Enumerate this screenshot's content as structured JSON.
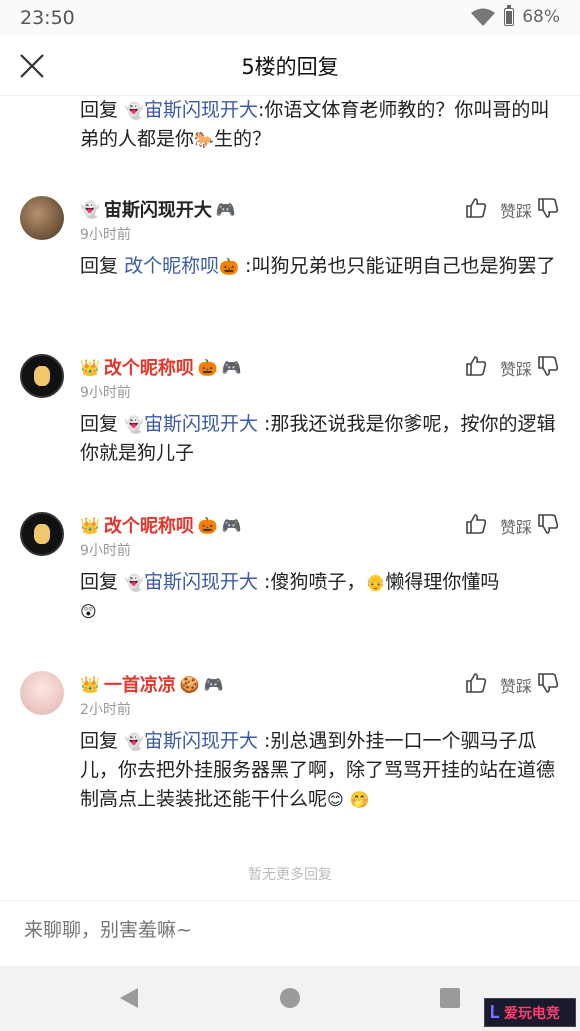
{
  "status": {
    "time": "23:50",
    "battery": "68%"
  },
  "header": {
    "title": "5楼的回复"
  },
  "first_reply": {
    "prefix": "回复",
    "mention": "宙斯闪现开大",
    "text_a": ":你语文体育老师教的？你叫哥的叫弟的人都是你",
    "text_b": "生的？"
  },
  "comments": [
    {
      "name": "宙斯闪现开大",
      "time": "9小时前",
      "reply_prefix": "回复",
      "reply_to": "改个昵称呗",
      "text": ":叫狗兄弟也只能证明自己也是狗罢了",
      "like_label": "赞踩"
    },
    {
      "name": "改个昵称呗",
      "time": "9小时前",
      "reply_prefix": "回复",
      "reply_to": "宙斯闪现开大",
      "text": ":那我还说我是你爹呢，按你的逻辑你就是狗儿子",
      "like_label": "赞踩"
    },
    {
      "name": "改个昵称呗",
      "time": "9小时前",
      "reply_prefix": "回复",
      "reply_to": "宙斯闪现开大",
      "text_a": ":傻狗喷子，",
      "text_b": "懒得理你懂吗",
      "like_label": "赞踩"
    },
    {
      "name": "一首凉凉",
      "time": "2小时前",
      "reply_prefix": "回复",
      "reply_to": "宙斯闪现开大",
      "text": ":别总遇到外挂一口一个驷马子瓜儿，你去把外挂服务器黑了啊，除了骂骂开挂的站在道德制高点上装装批还能干什么呢",
      "like_label": "赞踩"
    }
  ],
  "footer": {
    "no_more": "暂无更多回复"
  },
  "input": {
    "placeholder": "来聊聊，别害羞嘛~"
  },
  "watermark": {
    "text": "爱玩电竞"
  },
  "colors": {
    "mention": "#3b5ba5",
    "vip_name": "#e3362c",
    "muted": "#999999"
  }
}
